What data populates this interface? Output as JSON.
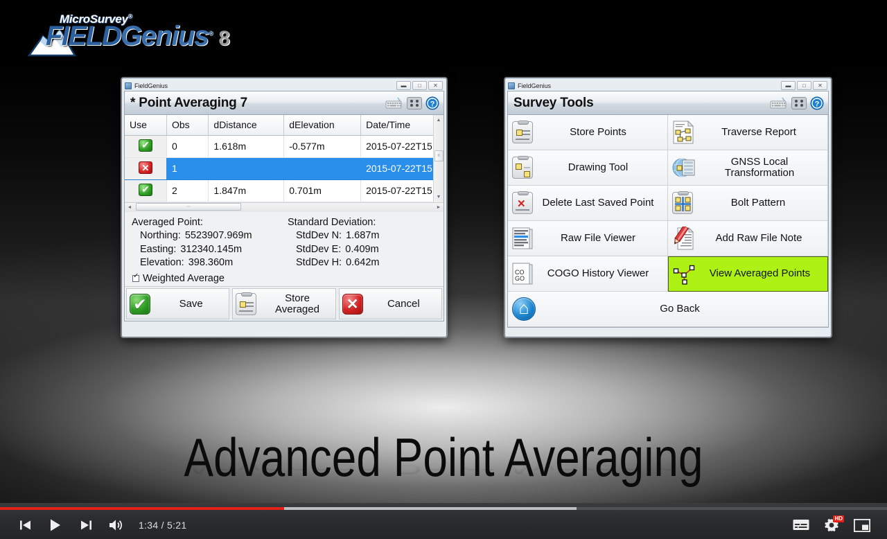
{
  "logo": {
    "top": "MicroSurvey",
    "reg": "®",
    "field": "FIELD",
    "genius": "Genius",
    "genius_reg": "®",
    "version": "8"
  },
  "left_window": {
    "titlebar": {
      "app": "FieldGenius",
      "minimize": "▬",
      "maximize": "□",
      "close": "✕"
    },
    "header": {
      "title": "* Point Averaging 7",
      "keyboard_icon": "keyboard-icon",
      "keypad_icon": "keypad-icon",
      "help_icon": "help-icon"
    },
    "table": {
      "columns": [
        "Use",
        "Obs",
        "dDistance",
        "dElevation",
        "Date/Time"
      ],
      "rows": [
        {
          "use": "enabled",
          "obs": "0",
          "ddistance": "1.618m",
          "delevation": "-0.577m",
          "datetime": "2015-07-22T15..",
          "selected": false
        },
        {
          "use": "disabled",
          "obs": "1",
          "ddistance": "",
          "delevation": "",
          "datetime": "2015-07-22T15..",
          "selected": true
        },
        {
          "use": "enabled",
          "obs": "2",
          "ddistance": "1.847m",
          "delevation": "0.701m",
          "datetime": "2015-07-22T15..",
          "selected": false
        }
      ]
    },
    "info": {
      "averaged_heading": "Averaged Point:",
      "stddev_heading": "Standard Deviation:",
      "northing_label": "Northing:",
      "northing_value": "5523907.969m",
      "easting_label": "Easting:",
      "easting_value": "312340.145m",
      "elevation_label": "Elevation:",
      "elevation_value": "398.360m",
      "stddev_n_label": "StdDev N:",
      "stddev_n_value": "1.687m",
      "stddev_e_label": "StdDev E:",
      "stddev_e_value": "0.409m",
      "stddev_h_label": "StdDev H:",
      "stddev_h_value": "0.642m",
      "weighted_average": "Weighted Average",
      "weighted_average_checked": true
    },
    "buttons": {
      "save": "Save",
      "store_averaged_line1": "Store",
      "store_averaged_line2": "Averaged",
      "cancel": "Cancel"
    }
  },
  "right_window": {
    "titlebar": {
      "app": "FieldGenius",
      "minimize": "▬",
      "maximize": "□",
      "close": "✕"
    },
    "header": {
      "title": "Survey Tools",
      "keyboard_icon": "keyboard-icon",
      "keypad_icon": "keypad-icon",
      "help_icon": "help-icon"
    },
    "tools": [
      {
        "label": "Store Points",
        "icon": "clipboard-points-icon",
        "selected": false
      },
      {
        "label": "Traverse Report",
        "icon": "traverse-report-icon",
        "selected": false
      },
      {
        "label": "Drawing Tool",
        "icon": "clipboard-drawing-icon",
        "selected": false
      },
      {
        "label": "GNSS Local Transformation",
        "icon": "globe-table-icon",
        "selected": false
      },
      {
        "label": "Delete Last Saved Point",
        "icon": "clipboard-delete-icon",
        "selected": false
      },
      {
        "label": "Bolt Pattern",
        "icon": "bolt-pattern-icon",
        "selected": false
      },
      {
        "label": "Raw File Viewer",
        "icon": "raw-file-icon",
        "selected": false
      },
      {
        "label": "Add Raw File Note",
        "icon": "pencil-note-icon",
        "selected": false
      },
      {
        "label": "COGO History Viewer",
        "icon": "cogo-icon",
        "selected": false
      },
      {
        "label": "View Averaged Points",
        "icon": "averaged-points-icon",
        "selected": true
      }
    ],
    "go_back": {
      "label": "Go Back",
      "icon": "home-icon"
    }
  },
  "slide": {
    "title": "Advanced Point Averaging"
  },
  "player": {
    "previous_label": "previous-video-icon",
    "play_label": "play-icon",
    "next_label": "next-video-icon",
    "volume_label": "volume-icon",
    "time": "1:34 / 5:21",
    "current_time": "1:34",
    "duration": "5:21",
    "subtitles_label": "subtitles-icon",
    "settings_label": "settings-gear-icon",
    "hd_badge": "HD",
    "miniplayer_label": "miniplayer-icon",
    "progress_played_percent": 32,
    "progress_buffered_percent": 65,
    "accent_color": "#e52117"
  }
}
